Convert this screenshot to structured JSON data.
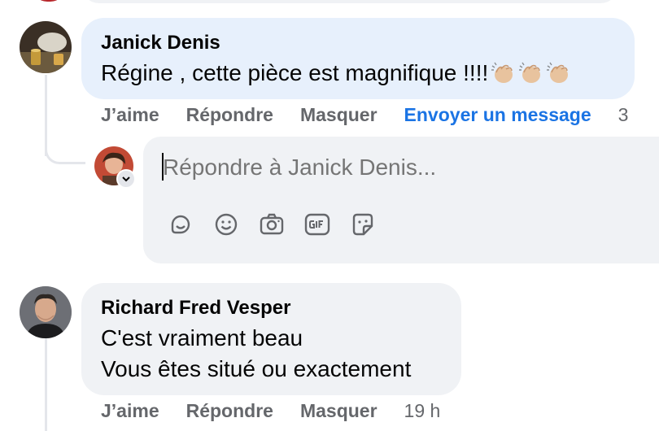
{
  "comments": [
    {
      "author": "Janick Denis",
      "text_lines": [
        "Régine , cette pièce est magnifique !!!!"
      ],
      "emoji": [
        "clapping-hands",
        "clapping-hands",
        "clapping-hands"
      ],
      "actions": {
        "like": "J’aime",
        "reply": "Répondre",
        "hide": "Masquer",
        "message": "Envoyer un message",
        "time": "3"
      }
    },
    {
      "author": "Richard Fred Vesper",
      "text_lines": [
        "C'est vraiment beau",
        "Vous êtes situé ou exactement"
      ],
      "actions": {
        "like": "J’aime",
        "reply": "Répondre",
        "hide": "Masquer",
        "time": "19 h"
      }
    }
  ],
  "composer": {
    "placeholder": "Répondre à Janick Denis...",
    "icons": [
      "sticker-icon",
      "emoji-icon",
      "camera-icon",
      "gif-icon",
      "avatar-sticker-icon"
    ]
  },
  "colors": {
    "highlight_bubble": "#e7f0fc",
    "bubble": "#f0f2f5",
    "link_blue": "#1b74e4",
    "secondary_text": "#65676b"
  }
}
